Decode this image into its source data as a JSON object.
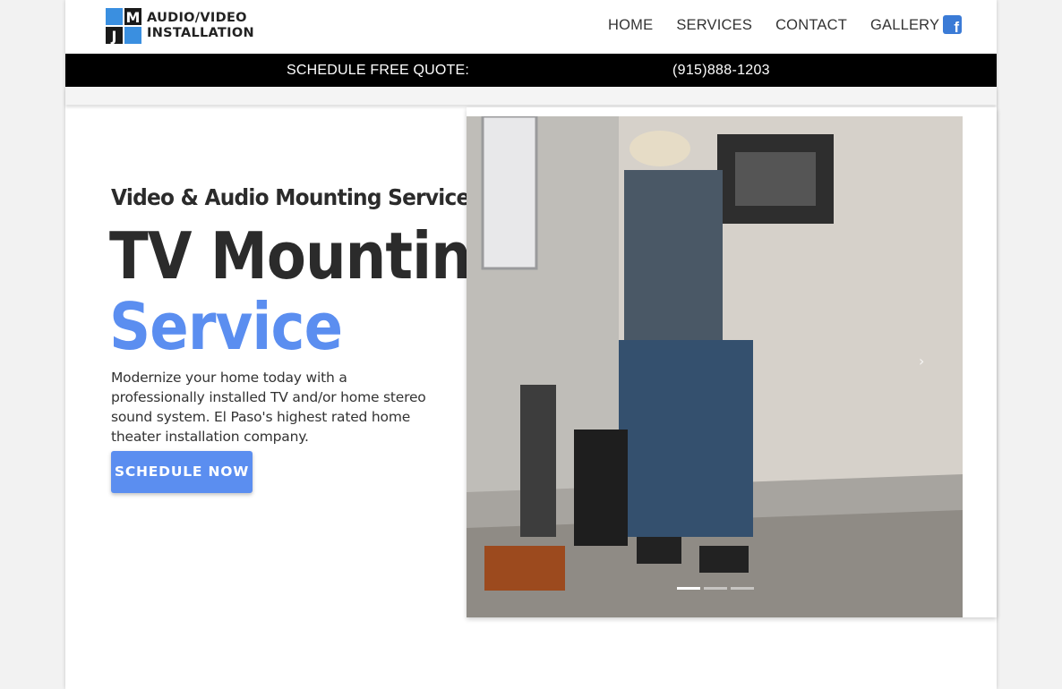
{
  "header": {
    "logo": {
      "letters": [
        "M",
        "J"
      ],
      "line1": "AUDIO/VIDEO",
      "line2": "INSTALLATION"
    },
    "nav": [
      {
        "label": "HOME"
      },
      {
        "label": "SERVICES"
      },
      {
        "label": "CONTACT"
      },
      {
        "label": "GALLERY"
      }
    ],
    "social_icon": "facebook-icon"
  },
  "quote_bar": {
    "label": "SCHEDULE FREE QUOTE:",
    "phone": "(915)888-1203"
  },
  "hero": {
    "subtitle": "Video & Audio Mounting Service",
    "title_line1": "TV Mounting",
    "title_line2": "Service",
    "description": "Modernize your home today with a professionally installed TV and/or home stereo sound system. El Paso's highest rated home theater installation company.",
    "cta_label": "SCHEDULE NOW"
  },
  "carousel": {
    "next_icon": "chevron-right-icon",
    "slide_count": 3,
    "active_slide": 1
  },
  "colors": {
    "accent": "#5b8ef0",
    "bar": "#000000",
    "text": "#2b2b2b",
    "facebook": "#3b7bd6"
  }
}
